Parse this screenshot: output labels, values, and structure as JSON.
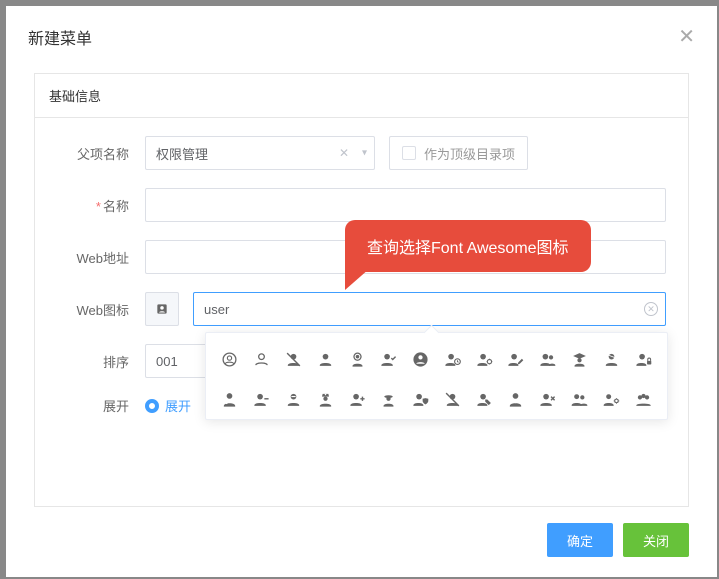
{
  "modal": {
    "title": "新建菜单"
  },
  "section": {
    "title": "基础信息"
  },
  "fields": {
    "parent": {
      "label": "父项名称",
      "value": "权限管理",
      "asTopLabel": "作为顶级目录项"
    },
    "name": {
      "label": "名称",
      "value": ""
    },
    "web_url": {
      "label": "Web地址",
      "value": ""
    },
    "web_icon": {
      "label": "Web图标",
      "value": "user"
    },
    "sort": {
      "label": "排序",
      "value": "001"
    },
    "expand": {
      "label": "展开",
      "option": "展开"
    }
  },
  "callout": {
    "text": "查询选择Font Awesome图标"
  },
  "icons": [
    "user-circle-o",
    "user-o",
    "user-slash",
    "user",
    "user-astronaut",
    "user-check",
    "user-circle",
    "user-clock",
    "user-cog",
    "user-edit",
    "user-friends",
    "user-graduate",
    "user-injured",
    "user-lock",
    "user-md",
    "user-minus",
    "user-ninja",
    "user-nurse",
    "user-plus",
    "user-secret",
    "user-shield",
    "user-slash-alt",
    "user-tag",
    "user-tie",
    "user-times",
    "users",
    "users-cog",
    "users-group"
  ],
  "footer": {
    "ok": "确定",
    "close": "关闭"
  }
}
